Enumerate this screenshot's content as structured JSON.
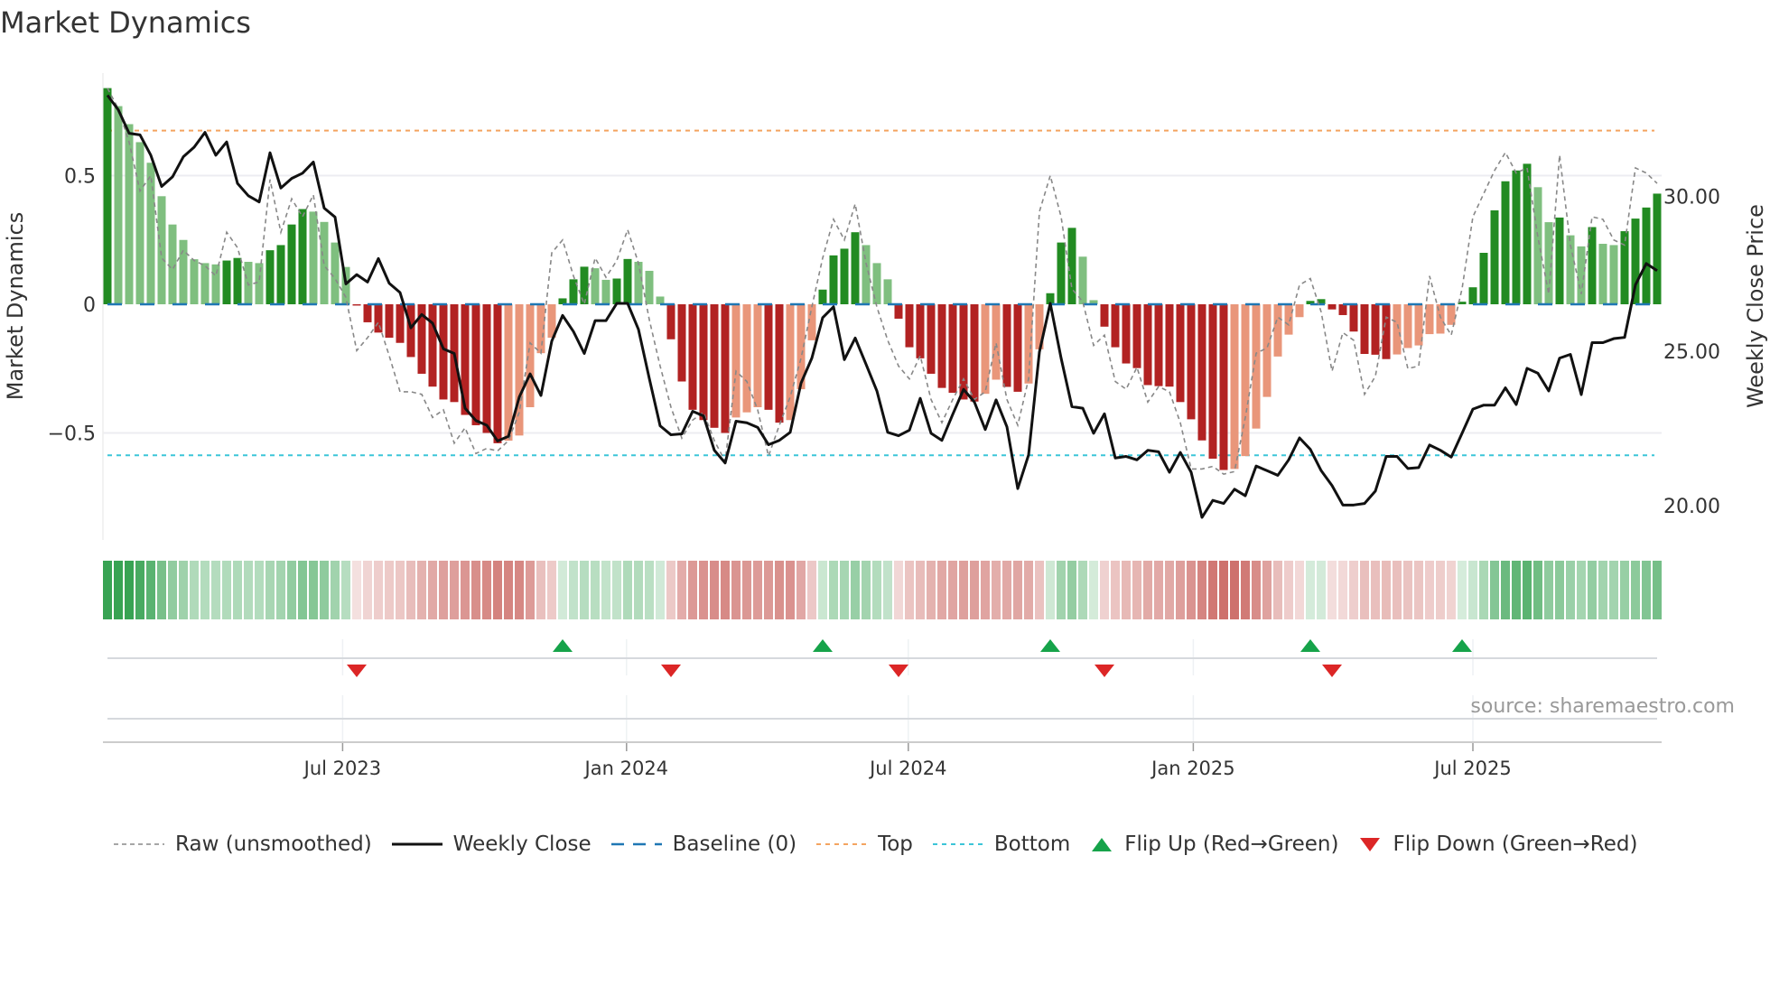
{
  "title": "Market Dynamics",
  "y_left_label": "Market Dynamics",
  "y_right_label": "Weekly Close Price",
  "source": "source: sharemaestro.com",
  "legend": [
    {
      "label": "Raw (unsmoothed)",
      "kind": "raw"
    },
    {
      "label": "Weekly Close",
      "kind": "close"
    },
    {
      "label": "Baseline (0)",
      "kind": "baseline"
    },
    {
      "label": "Top",
      "kind": "top"
    },
    {
      "label": "Bottom",
      "kind": "bottom"
    },
    {
      "label": "Flip Up (Red→Green)",
      "kind": "up"
    },
    {
      "label": "Flip Down (Green→Red)",
      "kind": "down"
    }
  ],
  "colors": {
    "pos_rising": "#228b22",
    "pos_falling": "#7fbf7f",
    "neg_falling": "#b22222",
    "neg_rising": "#e9967a",
    "raw": "#888888",
    "close": "#111111",
    "baseline": "#1f77b4",
    "top": "#f4a460",
    "bottom": "#3cc5d8",
    "flip_up": "#16a34a",
    "flip_down": "#dc2626"
  },
  "chart_data": {
    "type": "bar",
    "title": "Market Dynamics",
    "ylabel": "Market Dynamics",
    "y2label": "Weekly Close Price",
    "ylim": [
      -0.92,
      0.92
    ],
    "y2lim": [
      18.8,
      34.1
    ],
    "yticks": [
      {
        "v": 0.5,
        "label": "0.5"
      },
      {
        "v": 0,
        "label": "0"
      },
      {
        "v": -0.5,
        "label": "−0.5"
      }
    ],
    "y2ticks": [
      {
        "v": 30,
        "label": "30.00"
      },
      {
        "v": 25,
        "label": "25.00"
      },
      {
        "v": 20,
        "label": "20.00"
      }
    ],
    "xticks": [
      {
        "label": "Jul 2023",
        "week": 21.7
      },
      {
        "label": "Jan 2024",
        "week": 47.9
      },
      {
        "label": "Jul 2024",
        "week": 73.9
      },
      {
        "label": "Jan 2025",
        "week": 100.2
      },
      {
        "label": "Jul 2025",
        "week": 126
      }
    ],
    "top": 0.675,
    "bottom": -0.587,
    "baseline": 0,
    "dynamics": [
      0.84,
      0.77,
      0.7,
      0.63,
      0.55,
      0.42,
      0.31,
      0.25,
      0.175,
      0.16,
      0.155,
      0.17,
      0.18,
      0.165,
      0.16,
      0.21,
      0.23,
      0.31,
      0.37,
      0.36,
      0.32,
      0.24,
      0.145,
      -0.005,
      -0.07,
      -0.11,
      -0.13,
      -0.15,
      -0.205,
      -0.27,
      -0.32,
      -0.37,
      -0.38,
      -0.43,
      -0.47,
      -0.5,
      -0.54,
      -0.53,
      -0.51,
      -0.4,
      -0.19,
      -0.13,
      0.023,
      0.097,
      0.146,
      0.14,
      0.095,
      0.1,
      0.176,
      0.165,
      0.13,
      0.03,
      -0.136,
      -0.3,
      -0.41,
      -0.45,
      -0.48,
      -0.5,
      -0.44,
      -0.42,
      -0.4,
      -0.41,
      -0.46,
      -0.45,
      -0.33,
      -0.14,
      0.057,
      0.19,
      0.216,
      0.28,
      0.23,
      0.16,
      0.097,
      -0.056,
      -0.167,
      -0.21,
      -0.27,
      -0.325,
      -0.344,
      -0.37,
      -0.378,
      -0.348,
      -0.293,
      -0.321,
      -0.34,
      -0.308,
      -0.175,
      0.043,
      0.24,
      0.297,
      0.185,
      0.016,
      -0.087,
      -0.167,
      -0.23,
      -0.248,
      -0.314,
      -0.318,
      -0.32,
      -0.38,
      -0.447,
      -0.529,
      -0.6,
      -0.644,
      -0.64,
      -0.59,
      -0.483,
      -0.36,
      -0.203,
      -0.118,
      -0.05,
      0.013,
      0.02,
      -0.02,
      -0.042,
      -0.106,
      -0.193,
      -0.196,
      -0.213,
      -0.195,
      -0.17,
      -0.16,
      -0.116,
      -0.114,
      -0.08,
      0.01,
      0.066,
      0.2,
      0.365,
      0.478,
      0.52,
      0.546,
      0.455,
      0.319,
      0.337,
      0.268,
      0.225,
      0.3,
      0.235,
      0.23,
      0.284,
      0.333,
      0.376,
      0.43
    ],
    "raw": [
      0.84,
      0.76,
      0.63,
      0.44,
      0.5,
      0.18,
      0.135,
      0.21,
      0.17,
      0.15,
      0.11,
      0.28,
      0.22,
      0.075,
      0.087,
      0.485,
      0.28,
      0.41,
      0.34,
      0.425,
      0.15,
      0.1,
      0.027,
      -0.18,
      -0.13,
      -0.07,
      -0.2,
      -0.34,
      -0.34,
      -0.35,
      -0.44,
      -0.41,
      -0.54,
      -0.48,
      -0.58,
      -0.56,
      -0.57,
      -0.53,
      -0.42,
      -0.15,
      -0.19,
      0.2,
      0.25,
      0.11,
      0.0,
      0.18,
      0.105,
      0.17,
      0.29,
      0.16,
      -0.06,
      -0.24,
      -0.4,
      -0.52,
      -0.45,
      -0.42,
      -0.53,
      -0.61,
      -0.26,
      -0.3,
      -0.41,
      -0.59,
      -0.47,
      -0.36,
      -0.21,
      -0.01,
      0.18,
      0.33,
      0.25,
      0.39,
      0.16,
      -0.01,
      -0.14,
      -0.24,
      -0.29,
      -0.2,
      -0.37,
      -0.46,
      -0.37,
      -0.29,
      -0.37,
      -0.34,
      -0.15,
      -0.37,
      -0.47,
      -0.29,
      0.36,
      0.5,
      0.34,
      0.06,
      0.01,
      -0.16,
      -0.12,
      -0.3,
      -0.33,
      -0.245,
      -0.38,
      -0.32,
      -0.34,
      -0.46,
      -0.64,
      -0.64,
      -0.63,
      -0.66,
      -0.65,
      -0.44,
      -0.19,
      -0.17,
      -0.05,
      -0.08,
      0.075,
      0.1,
      -0.03,
      -0.26,
      -0.11,
      -0.14,
      -0.35,
      -0.28,
      -0.05,
      -0.07,
      -0.25,
      -0.24,
      0.11,
      -0.05,
      -0.12,
      0.06,
      0.34,
      0.43,
      0.52,
      0.59,
      0.51,
      0.53,
      0.26,
      0.04,
      0.58,
      0.23,
      0.04,
      0.34,
      0.33,
      0.25,
      0.23,
      0.53,
      0.51,
      0.47
    ],
    "close": [
      33.27,
      32.8,
      32.04,
      31.99,
      31.33,
      30.32,
      30.63,
      31.28,
      31.59,
      32.07,
      31.33,
      31.76,
      30.42,
      30.02,
      29.82,
      31.41,
      30.27,
      30.58,
      30.75,
      31.11,
      29.62,
      29.33,
      27.17,
      27.47,
      27.23,
      27.99,
      27.19,
      26.89,
      25.75,
      26.18,
      25.9,
      25.07,
      24.92,
      23.15,
      22.75,
      22.6,
      22.09,
      22.24,
      23.51,
      24.26,
      23.56,
      25.32,
      26.15,
      25.63,
      24.92,
      25.98,
      25.98,
      26.54,
      26.54,
      25.7,
      24.11,
      22.58,
      22.29,
      22.32,
      23.05,
      22.9,
      21.79,
      21.38,
      22.73,
      22.68,
      22.53,
      21.97,
      22.11,
      22.37,
      23.96,
      24.77,
      26.08,
      26.43,
      24.72,
      25.42,
      24.57,
      23.71,
      22.37,
      22.26,
      22.44,
      23.47,
      22.34,
      22.11,
      22.95,
      23.76,
      23.35,
      22.46,
      23.42,
      22.55,
      20.55,
      21.64,
      24.97,
      26.54,
      24.77,
      23.2,
      23.15,
      22.34,
      22.97,
      21.54,
      21.59,
      21.48,
      21.79,
      21.74,
      21.08,
      21.72,
      21.08,
      19.62,
      20.17,
      20.07,
      20.53,
      20.32,
      21.28,
      21.13,
      20.98,
      21.48,
      22.19,
      21.82,
      21.13,
      20.65,
      20.02,
      20.02,
      20.07,
      20.47,
      21.59,
      21.59,
      21.2,
      21.23,
      21.96,
      21.79,
      21.57,
      22.34,
      23.12,
      23.25,
      23.25,
      23.81,
      23.27,
      24.44,
      24.28,
      23.71,
      24.77,
      24.89,
      23.59,
      25.27,
      25.27,
      25.4,
      25.44,
      27.14,
      27.83,
      27.6
    ],
    "flips_up": [
      42,
      66,
      87,
      111,
      125
    ],
    "flips_down": [
      23,
      52,
      73,
      92,
      113
    ]
  }
}
